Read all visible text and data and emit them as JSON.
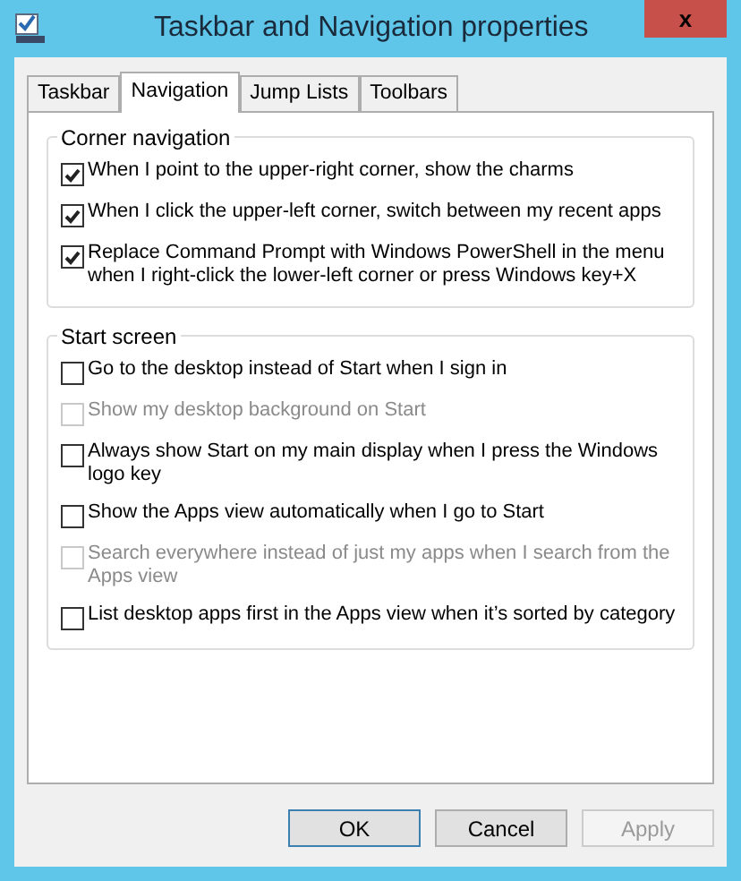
{
  "window": {
    "title": "Taskbar and Navigation properties",
    "close": "x"
  },
  "tabs": [
    {
      "label": "Taskbar",
      "selected": false
    },
    {
      "label": "Navigation",
      "selected": true
    },
    {
      "label": "Jump Lists",
      "selected": false
    },
    {
      "label": "Toolbars",
      "selected": false
    }
  ],
  "groups": [
    {
      "title": "Corner navigation",
      "options": [
        {
          "label": "When I point to the upper-right corner, show the charms",
          "checked": true,
          "disabled": false
        },
        {
          "label": "When I click the upper-left corner, switch between my recent apps",
          "checked": true,
          "disabled": false
        },
        {
          "label": "Replace Command Prompt with Windows PowerShell in the menu when I right-click the lower-left corner or press Windows key+X",
          "checked": true,
          "disabled": false
        }
      ]
    },
    {
      "title": "Start screen",
      "options": [
        {
          "label": "Go to the desktop instead of Start when I sign in",
          "checked": false,
          "disabled": false
        },
        {
          "label": "Show my desktop background on Start",
          "checked": false,
          "disabled": true
        },
        {
          "label": "Always show Start on my main display when I press the Windows logo key",
          "checked": false,
          "disabled": false
        },
        {
          "label": "Show the Apps view automatically when I go to Start",
          "checked": false,
          "disabled": false
        },
        {
          "label": "Search everywhere instead of just my apps when I search from the Apps view",
          "checked": false,
          "disabled": true
        },
        {
          "label": "List desktop apps first in the Apps view when it’s sorted by category",
          "checked": false,
          "disabled": false
        }
      ]
    }
  ],
  "buttons": [
    {
      "label": "OK",
      "kind": "default",
      "disabled": false
    },
    {
      "label": "Cancel",
      "kind": "normal",
      "disabled": false
    },
    {
      "label": "Apply",
      "kind": "normal",
      "disabled": true
    }
  ]
}
